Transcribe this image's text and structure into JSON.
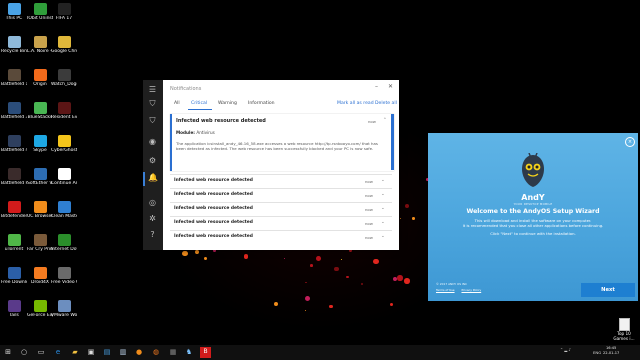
{
  "desktop": {
    "icons": [
      {
        "label": "This PC",
        "color": "#4aa3e6"
      },
      {
        "label": "IObit Uninstaller",
        "color": "#2f9e3a"
      },
      {
        "label": "FIFA 17",
        "color": "#222222"
      },
      {
        "label": "Recycle Bin",
        "color": "#8fb9d9"
      },
      {
        "label": "L.A. Noire - Complet...",
        "color": "#c9a24b"
      },
      {
        "label": "Google Chrome",
        "color": "#e0b83a"
      },
      {
        "label": "Battlefield 1",
        "color": "#5a4a3a"
      },
      {
        "label": "Origin",
        "color": "#f26a1b"
      },
      {
        "label": "Watch_Dogs 2",
        "color": "#3b3b3b"
      },
      {
        "label": "Battlefield 3",
        "color": "#2b4d7a"
      },
      {
        "label": "BlueStacks",
        "color": "#49b653"
      },
      {
        "label": "Resident Evil 7 Biohaz...",
        "color": "#5b1515"
      },
      {
        "label": "Battlefield 4",
        "color": "#2e3f5e"
      },
      {
        "label": "Skype",
        "color": "#1ea8e4"
      },
      {
        "label": "CyberGhost 6",
        "color": "#f4c51b"
      },
      {
        "label": "Battlefield Hardline",
        "color": "#3a2b2b"
      },
      {
        "label": "SoftEther VPN Clie...",
        "color": "#2d6db3"
      },
      {
        "label": "Continue AndyOS...",
        "color": "#ffffff"
      },
      {
        "label": "Bitdefender 2017",
        "color": "#d21b1b"
      },
      {
        "label": "UC Browser",
        "color": "#f08c1b"
      },
      {
        "label": "Clean Master",
        "color": "#2f7fd1"
      },
      {
        "label": "uTorrent",
        "color": "#50b748"
      },
      {
        "label": "Far Cry Primal",
        "color": "#7a5a3a"
      },
      {
        "label": "Internet Downlo...",
        "color": "#2b8f2b"
      },
      {
        "label": "Free Downloa...",
        "color": "#2b5fa8"
      },
      {
        "label": "Droid4X",
        "color": "#f47b20"
      },
      {
        "label": "Free Video Cutter Joiner",
        "color": "#6a6a6a"
      },
      {
        "label": "Tails",
        "color": "#5a3a8a"
      },
      {
        "label": "GeForce Experience",
        "color": "#76b900"
      },
      {
        "label": "VMware Workstation",
        "color": "#6c8ebf"
      }
    ],
    "file_label": "Top 10 Games i..."
  },
  "notifications": {
    "title": "Notifications",
    "minimize": "–",
    "close": "✕",
    "tabs": [
      "All",
      "Critical",
      "Warning",
      "Information"
    ],
    "active_tab": "Critical",
    "mark_all": "Mark all as read",
    "delete_all": "Delete all",
    "expanded": {
      "title": "Infected web resource detected",
      "time": "now",
      "module_label": "Module:",
      "module_value": "Antivirus",
      "body": "The application icsinstall_andy_46.16_58.exe accesses a web resource http://tp.rsnbooyo.com/ that has been detected as infected. The web resource has been successfully blocked and your PC is now safe."
    },
    "rows": [
      {
        "title": "Infected web resource detected",
        "time": "now"
      },
      {
        "title": "Infected web resource detected",
        "time": "now"
      },
      {
        "title": "Infected web resource detected",
        "time": "now"
      },
      {
        "title": "Infected web resource detected",
        "time": "now"
      },
      {
        "title": "Infected web resource detected",
        "time": "now"
      }
    ]
  },
  "wizard": {
    "brand": "AndY",
    "tagline": "YOUR DESKTOP MOBILE",
    "heading": "Welcome to the AndyOS Setup Wizard",
    "desc1": "This will download and install the software on your computer.",
    "desc2": "It is recommended that you close all other applications before continuing.",
    "desc3": "Click \"Next\" to continue with the installation.",
    "copyright": "© 2017 ANDY OS INC",
    "terms": "Terms of Use",
    "privacy": "Privacy Policy",
    "next": "Next",
    "close": "×"
  },
  "taskbar": {
    "lang": "ENG",
    "time": "16:45",
    "date": "22-01-17"
  },
  "colors": {
    "accent": "#2a6fd1",
    "critical": "#ff5a5a",
    "wizard_bg": "#4aa4dc",
    "next_button": "#1e7fd1"
  }
}
